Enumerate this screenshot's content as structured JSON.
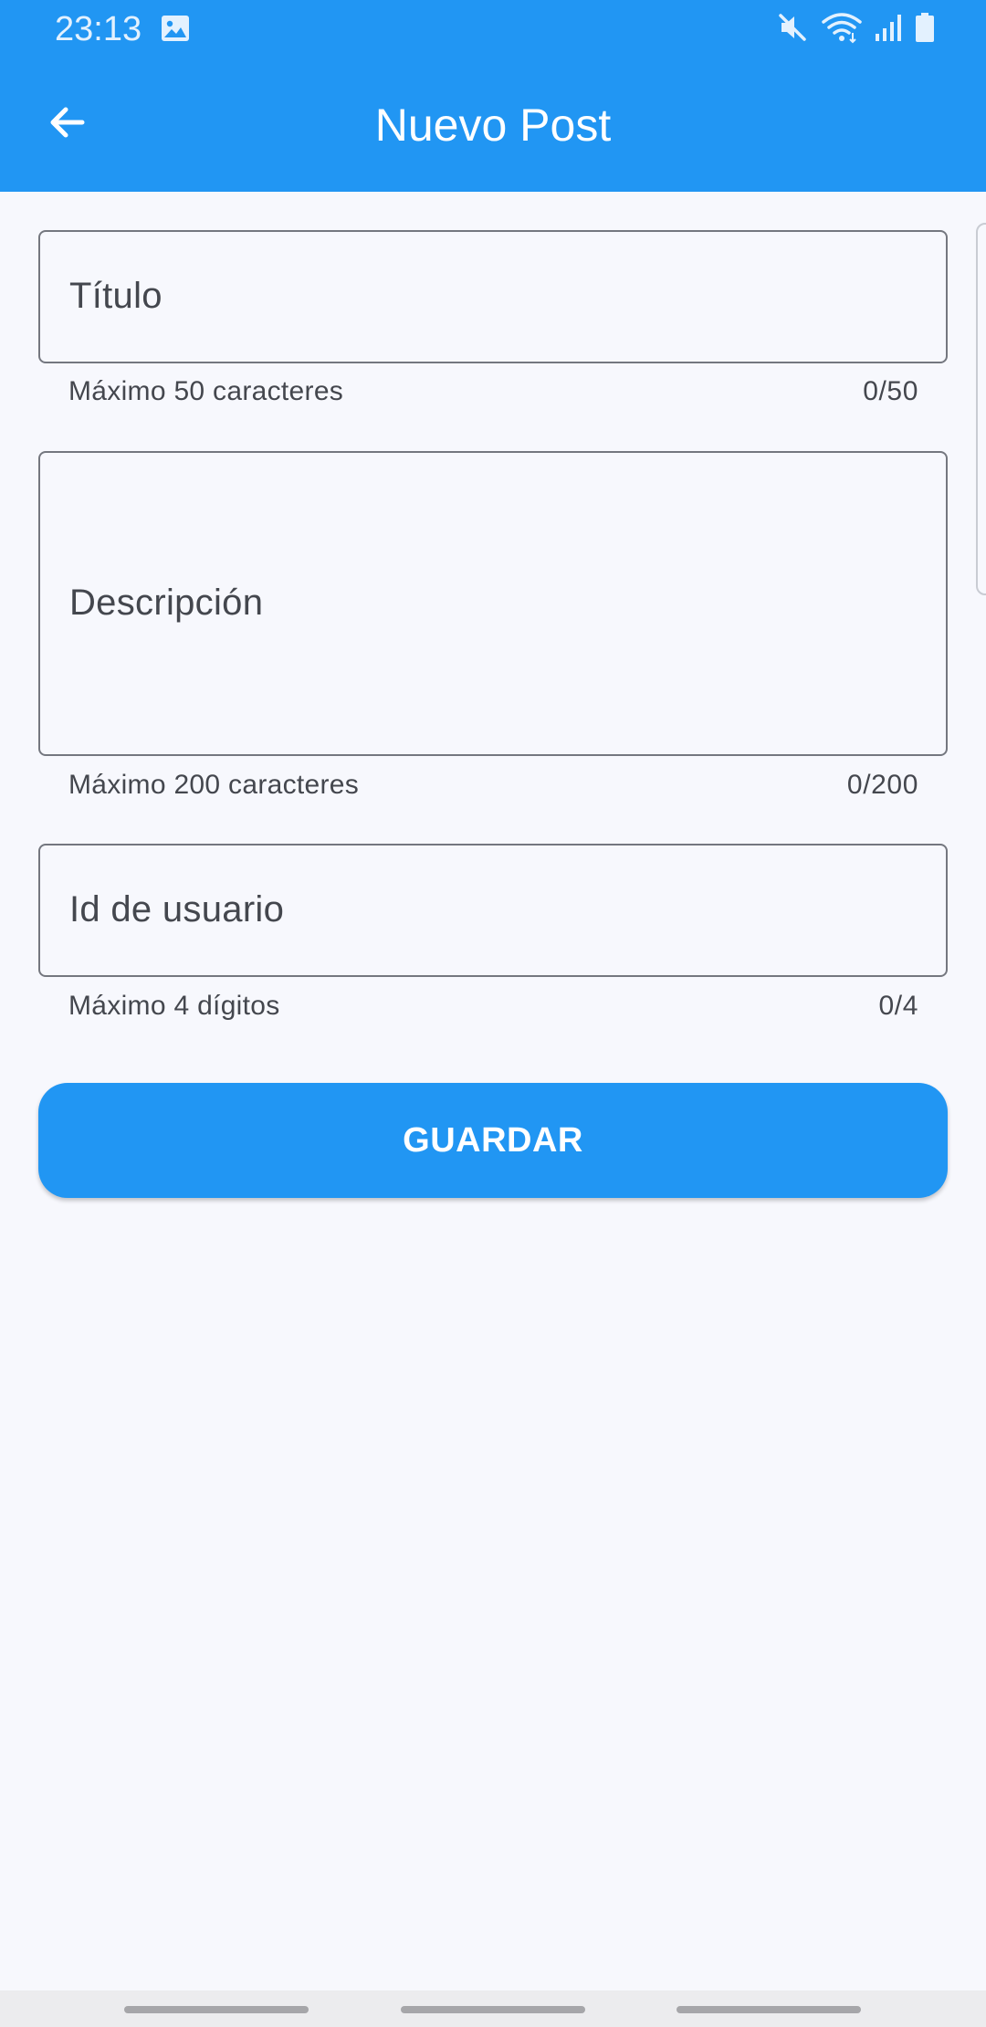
{
  "status_bar": {
    "time": "23:13",
    "icons": [
      "gallery-icon",
      "mute-icon",
      "wifi-icon",
      "signal-icon",
      "battery-icon"
    ]
  },
  "app_bar": {
    "title": "Nuevo Post",
    "back_icon": "arrow-left-icon",
    "background_color": "#2196F3"
  },
  "form": {
    "title_field": {
      "placeholder": "Título",
      "value": "",
      "helper": "Máximo 50 caracteres",
      "counter": "0/50"
    },
    "description_field": {
      "placeholder": "Descripción",
      "value": "",
      "helper": "Máximo 200 caracteres",
      "counter": "0/200"
    },
    "user_id_field": {
      "placeholder": "Id de usuario",
      "value": "",
      "helper": "Máximo 4 dígitos",
      "counter": "0/4"
    },
    "save_button": {
      "label": "GUARDAR",
      "color": "#2196F3"
    }
  },
  "colors": {
    "page_background": "#F7F8FD",
    "field_border": "#74777F",
    "text_secondary": "#44474E"
  }
}
